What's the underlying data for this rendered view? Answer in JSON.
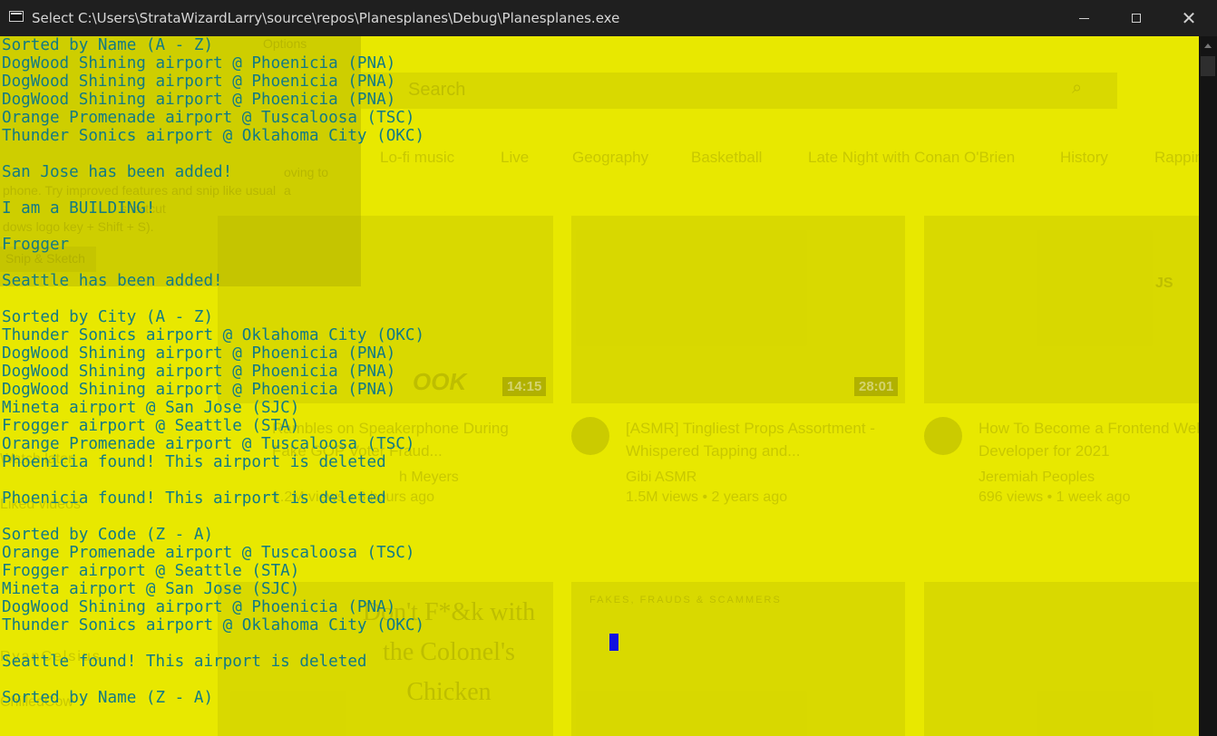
{
  "window": {
    "title": "Select C:\\Users\\StrataWizardLarry\\source\\repos\\Planesplanes\\Debug\\Planesplanes.exe",
    "minimize_icon": "minimize-icon",
    "maximize_icon": "maximize-icon",
    "close_icon": "close-icon"
  },
  "console": {
    "background_color": "#e8e800",
    "text_color": "#117a86",
    "cursor_color": "#1010e0",
    "lines": [
      "Sorted by Name (A - Z)",
      "DogWood Shining airport @ Phoenicia (PNA)",
      "DogWood Shining airport @ Phoenicia (PNA)",
      "DogWood Shining airport @ Phoenicia (PNA)",
      "Orange Promenade airport @ Tuscaloosa (TSC)",
      "Thunder Sonics airport @ Oklahoma City (OKC)",
      "",
      "San Jose has been added!",
      "",
      "I am a BUILDING!",
      "",
      "Frogger",
      "",
      "Seattle has been added!",
      "",
      "Sorted by City (A - Z)",
      "Thunder Sonics airport @ Oklahoma City (OKC)",
      "DogWood Shining airport @ Phoenicia (PNA)",
      "DogWood Shining airport @ Phoenicia (PNA)",
      "DogWood Shining airport @ Phoenicia (PNA)",
      "Mineta airport @ San Jose (SJC)",
      "Frogger airport @ Seattle (STA)",
      "Orange Promenade airport @ Tuscaloosa (TSC)",
      "Phoenicia found! This airport is deleted",
      "",
      "Phoenicia found! This airport is deleted",
      "",
      "Sorted by Code (Z - A)",
      "Orange Promenade airport @ Tuscaloosa (TSC)",
      "Frogger airport @ Seattle (STA)",
      "Mineta airport @ San Jose (SJC)",
      "DogWood Shining airport @ Phoenicia (PNA)",
      "Thunder Sonics airport @ Oklahoma City (OKC)",
      "",
      "Seattle found! This airport is deleted",
      "",
      "Sorted by Name (Z - A)"
    ]
  },
  "background_window": {
    "search_placeholder": "Search",
    "search_icon": "search-icon",
    "chips": [
      "Lo-fi music",
      "Live",
      "Geography",
      "Basketball",
      "Late Night with Conan O'Brien",
      "History",
      "Rapping"
    ],
    "snip_text_lines": [
      "oving to a",
      "phone. Try improved features and snip like usual",
      "shortcut",
      "dows logo key + Shift + S)."
    ],
    "snip_button": "Snip & Sketch",
    "options_label": "Options",
    "sidebar_items": [
      "Watch later",
      "Liked videos",
      "RyanCelsius...",
      "ChilledCow"
    ],
    "videos": [
      {
        "duration": "14:15",
        "title": "Rambles on Speakerphone During Fake GOP Voter Fraud...",
        "channel": "h Meyers",
        "meta": "1.2M views • 8 hours ago",
        "thumb_text": "OOK"
      },
      {
        "duration": "28:01",
        "title": "[ASMR] Tingliest Props Assortment - Whispered Tapping and...",
        "channel": "Gibi ASMR",
        "meta": "1.5M views • 2 years ago"
      },
      {
        "title": "How To Become a Frontend Web Developer for 2021",
        "channel": "Jeremiah Peoples",
        "meta": "696 views • 1 week ago",
        "thumb_text": "JS"
      }
    ],
    "bottom_thumbs": [
      "Don't F*&k with the Colonel's Chicken",
      "FAKES, FRAUDS & SCAMMERS"
    ]
  }
}
